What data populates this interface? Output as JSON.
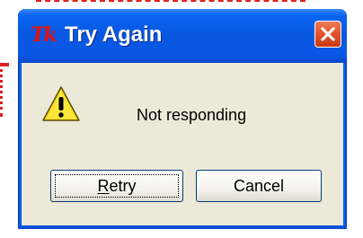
{
  "dialog": {
    "app_icon_text": "Tk",
    "title": "Try Again",
    "message": "Not responding",
    "icon": "warning-icon",
    "close_icon": "close-icon"
  },
  "buttons": {
    "retry_label_first": "R",
    "retry_label_rest": "etry",
    "cancel_label": "Cancel"
  },
  "colors": {
    "titlebar": "#0857e0",
    "client_bg": "#ece9d8",
    "close_button": "#e2522c",
    "warning_yellow": "#f8e020"
  }
}
